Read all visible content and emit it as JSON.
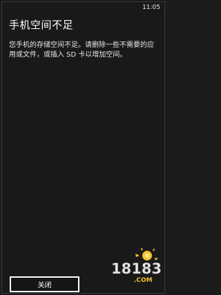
{
  "status_bar": {
    "time": "11:05"
  },
  "dialog": {
    "title": "手机空间不足",
    "message": "您手机的存储空间不足。请删除一些不需要的应用或文件，或插入 SD 卡以增加空间。",
    "close_label": "关闭"
  },
  "watermark": {
    "text": "18183",
    "sub": ".COM"
  }
}
